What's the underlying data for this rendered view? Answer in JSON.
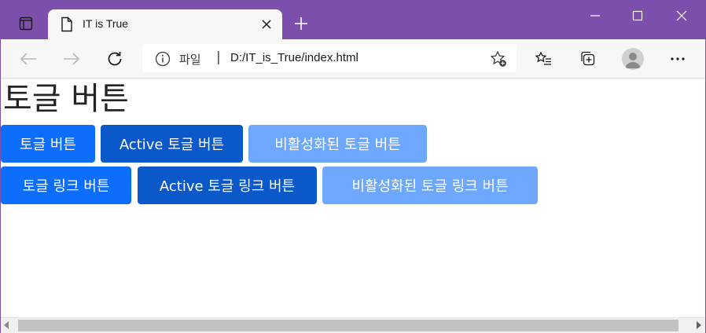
{
  "browser": {
    "tab_title": "IT is True",
    "file_label": "파일",
    "separator": "|",
    "url": "D:/IT_is_True/index.html"
  },
  "page": {
    "heading": "토글 버튼",
    "toggle_buttons": [
      {
        "label": "토글 버튼",
        "state": "normal"
      },
      {
        "label": "Active 토글 버튼",
        "state": "active"
      },
      {
        "label": "비활성화된 토글 버튼",
        "state": "disabled"
      }
    ],
    "toggle_link_buttons": [
      {
        "label": "토글 링크 버튼",
        "state": "normal"
      },
      {
        "label": "Active 토글 링크 버튼",
        "state": "active"
      },
      {
        "label": "비활성화된 토글 링크 버튼",
        "state": "disabled"
      }
    ]
  },
  "colors": {
    "titlebar": "#7b4fab",
    "primary": "#0d6efd",
    "active": "#0a58ca",
    "disabled": "#6ea8fe"
  },
  "icons": {
    "sidebar": "tab-actions-icon",
    "page": "page-icon",
    "close": "close-icon",
    "new_tab": "plus-icon",
    "minimize": "minimize-icon",
    "maximize": "maximize-icon",
    "window_close": "window-close-icon",
    "back": "back-arrow-icon",
    "forward": "forward-arrow-icon",
    "refresh": "refresh-icon",
    "info": "info-icon",
    "favorite_add": "star-add-icon",
    "favorites": "favorites-list-icon",
    "collections": "collections-icon",
    "profile": "profile-icon",
    "more": "more-icon"
  }
}
